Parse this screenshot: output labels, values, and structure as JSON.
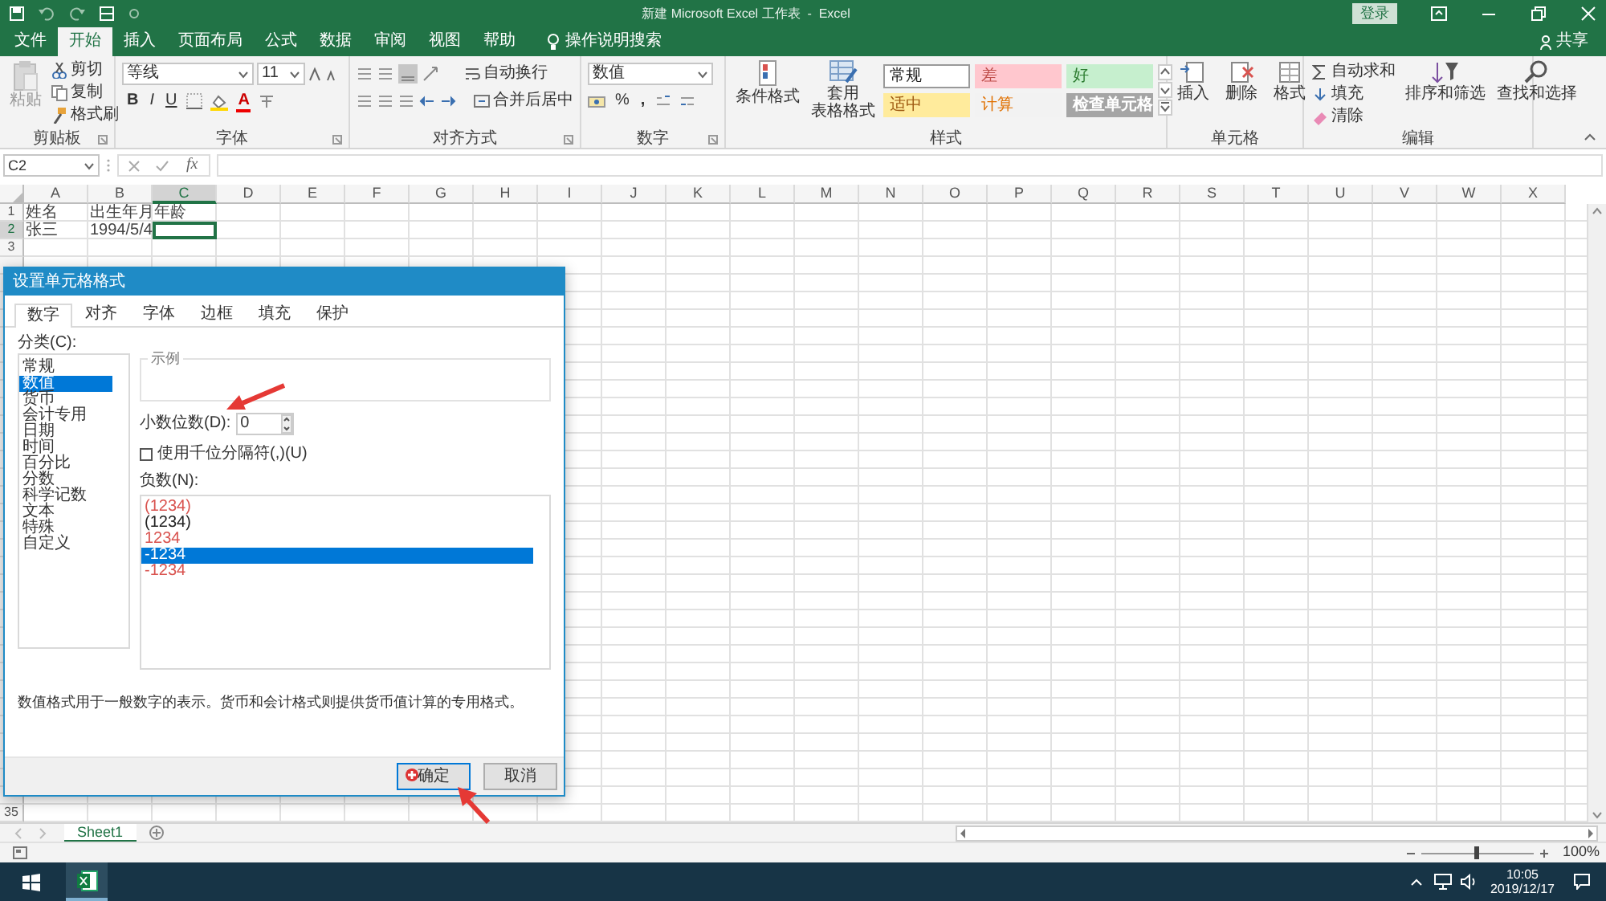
{
  "title_bar": {
    "title": "新建 Microsoft Excel 工作表  -  Excel",
    "sign_in": "登录"
  },
  "menu_tabs": [
    {
      "label": "文件",
      "selected": false
    },
    {
      "label": "开始",
      "selected": true
    },
    {
      "label": "插入",
      "selected": false
    },
    {
      "label": "页面布局",
      "selected": false
    },
    {
      "label": "公式",
      "selected": false
    },
    {
      "label": "数据",
      "selected": false
    },
    {
      "label": "审阅",
      "selected": false
    },
    {
      "label": "视图",
      "selected": false
    },
    {
      "label": "帮助",
      "selected": false
    }
  ],
  "tell_me": "操作说明搜索",
  "share": "共享",
  "ribbon": {
    "clipboard": {
      "label": "剪贴板",
      "paste": "粘贴",
      "cut": "剪切",
      "copy": "复制",
      "format_painter": "格式刷"
    },
    "font": {
      "label": "字体",
      "font_name": "等线",
      "font_size": "11",
      "bold": "B",
      "italic": "I",
      "underline": "U",
      "font_color": "A"
    },
    "alignment": {
      "label": "对齐方式",
      "wrap_text": "自动换行",
      "merge_center": "合并后居中"
    },
    "number": {
      "label": "数字",
      "format": "数值",
      "percent": "%",
      "comma": ","
    },
    "styles": {
      "label": "样式",
      "conditional": "条件格式",
      "table_format": [
        "套用",
        "表格格式"
      ],
      "cell_styles": [
        {
          "text": "常规",
          "color": "#222222",
          "fill": {
            "color": "#ffffff"
          }
        },
        {
          "text": "差",
          "color": "#c0504d",
          "fill": {
            "color": "#ffc7ce"
          }
        },
        {
          "text": "好",
          "color": "#2e7d32",
          "fill": {
            "color": "#c6efce"
          }
        },
        {
          "text": "适中",
          "fill": {
            "color": "#ffeb9c"
          }
        },
        {
          "text": "计算",
          "color": "#e07000",
          "fill": {
            "color": "#f2f2f2"
          }
        },
        {
          "text": "检查单元格",
          "fill": {
            "color": "#a5a5a5"
          }
        }
      ]
    },
    "cells": {
      "label": "单元格",
      "buttons": [
        "插入",
        "删除",
        "格式"
      ]
    },
    "editing": {
      "label": "编辑",
      "autosum": "自动求和",
      "fill": "填充",
      "clear": "清除",
      "sort_filter": "排序和筛选",
      "find_select": "查找和选择"
    }
  },
  "formula_bar": {
    "name_box": "C2",
    "fx": "fx"
  },
  "sheet": {
    "columns": [
      {
        "label": "A",
        "selected": false
      },
      {
        "label": "B",
        "selected": false
      },
      {
        "label": "C",
        "selected": true
      },
      {
        "label": "D",
        "selected": false
      },
      {
        "label": "E",
        "selected": false
      },
      {
        "label": "F",
        "selected": false
      },
      {
        "label": "G",
        "selected": false
      },
      {
        "label": "H",
        "selected": false
      },
      {
        "label": "I",
        "selected": false
      },
      {
        "label": "J",
        "selected": false
      },
      {
        "label": "K",
        "selected": false
      },
      {
        "label": "L",
        "selected": false
      },
      {
        "label": "M",
        "selected": false
      },
      {
        "label": "N",
        "selected": false
      },
      {
        "label": "O",
        "selected": false
      },
      {
        "label": "P",
        "selected": false
      },
      {
        "label": "Q",
        "selected": false
      },
      {
        "label": "R",
        "selected": false
      },
      {
        "label": "S",
        "selected": false
      },
      {
        "label": "T",
        "selected": false
      },
      {
        "label": "U",
        "selected": false
      },
      {
        "label": "V",
        "selected": false
      },
      {
        "label": "W",
        "selected": false
      },
      {
        "label": "X",
        "selected": false
      }
    ],
    "rows": [
      {
        "number": "1",
        "selected": false,
        "cells": [
          {
            "text": "姓名",
            "kind": "text",
            "selected": false
          },
          {
            "text": "出生年月",
            "kind": "text",
            "selected": false
          },
          {
            "text": "年龄",
            "kind": "text",
            "selected": false
          }
        ]
      },
      {
        "number": "2",
        "selected": true,
        "cells": [
          {
            "text": "张三",
            "kind": "text",
            "selected": false
          },
          {
            "text": "1994/5/4",
            "kind": "number",
            "selected": false
          },
          {
            "kind": "text",
            "selected": true
          }
        ]
      },
      {
        "number": "3",
        "selected": false
      },
      {
        "number": "35",
        "selected": false
      }
    ]
  },
  "dialog": {
    "title": "设置单元格格式",
    "tabs": [
      {
        "label": "数字",
        "selected": true
      },
      {
        "label": "对齐",
        "selected": false
      },
      {
        "label": "字体",
        "selected": false
      },
      {
        "label": "边框",
        "selected": false
      },
      {
        "label": "填充",
        "selected": false
      },
      {
        "label": "保护",
        "selected": false
      }
    ],
    "category_label": "分类(C):",
    "categories": [
      {
        "label": "常规",
        "selected": false
      },
      {
        "label": "数值",
        "selected": true
      },
      {
        "label": "货币",
        "selected": false
      },
      {
        "label": "会计专用",
        "selected": false
      },
      {
        "label": "日期",
        "selected": false
      },
      {
        "label": "时间",
        "selected": false
      },
      {
        "label": "百分比",
        "selected": false
      },
      {
        "label": "分数",
        "selected": false
      },
      {
        "label": "科学记数",
        "selected": false
      },
      {
        "label": "文本",
        "selected": false
      },
      {
        "label": "特殊",
        "selected": false
      },
      {
        "label": "自定义",
        "selected": false
      }
    ],
    "sample_label": "示例",
    "decimal_label": "小数位数(D):",
    "decimal_value": "0",
    "thousands": {
      "label": "使用千位分隔符(,)(U)",
      "checked": false
    },
    "negative_label": "负数(N):",
    "negatives": [
      {
        "text": "(1234)",
        "color": "#d9534f",
        "selected": false
      },
      {
        "text": "(1234)",
        "color": "#222222",
        "selected": false
      },
      {
        "text": "1234",
        "color": "#d9534f",
        "selected": false
      },
      {
        "text": "-1234",
        "selected": true
      },
      {
        "text": "-1234",
        "color": "#d9534f",
        "selected": false
      }
    ],
    "description": "数值格式用于一般数字的表示。货币和会计格式则提供货币值计算的专用格式。",
    "ok": "确定",
    "cancel": "取消"
  },
  "sheet_tabs": [
    {
      "label": "Sheet1",
      "selected": true
    }
  ],
  "status_bar": {
    "zoom": "100%",
    "zoom_slider": {
      "level": 0.5
    }
  },
  "taskbar": {
    "time": "10:05",
    "date": "2019/12/17"
  }
}
